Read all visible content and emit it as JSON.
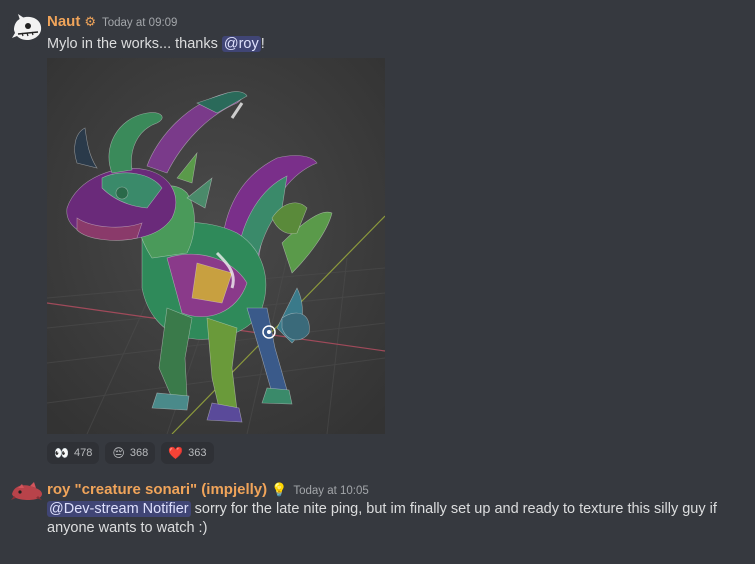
{
  "message1": {
    "username": "Naut",
    "username_color": "#f0a45a",
    "badge": "⚙",
    "timestamp": "Today at 09:09",
    "text_before": "Mylo in the works... thanks ",
    "mention": "@roy",
    "text_after": "!",
    "image_alt": "3D dragon model with UV checker texture in viewport",
    "reactions": [
      {
        "emoji": "👀",
        "count": "478"
      },
      {
        "emoji": "😔",
        "count": "368"
      },
      {
        "emoji": "❤️",
        "count": "363"
      }
    ]
  },
  "message2": {
    "username": "roy \"creature sonari\" (impjelly)",
    "username_color": "#f0a45a",
    "badge": "💡",
    "timestamp": "Today at 10:05",
    "mention": "@Dev-stream Notifier",
    "text": " sorry for the late nite ping, but im finally set up and ready to texture this silly guy if anyone wants to watch :)"
  }
}
